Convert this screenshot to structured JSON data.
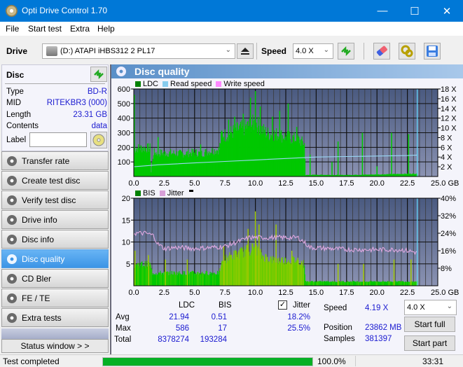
{
  "window": {
    "title": "Opti Drive Control 1.70",
    "minimize": "—",
    "maximize": "☐",
    "close": "✕"
  },
  "menu": [
    "File",
    "Start test",
    "Extra",
    "Help"
  ],
  "toolbar": {
    "drive_label": "Drive",
    "drive_value": "(D:)  ATAPI iHBS312  2 PL17",
    "speed_label": "Speed",
    "speed_value": "4.0 X",
    "icons": [
      "drive-icon",
      "eject-icon",
      "refresh-icon",
      "eraser-icon",
      "settings-icon",
      "save-icon"
    ]
  },
  "disc": {
    "header": "Disc",
    "rows": [
      {
        "label": "Type",
        "value": "BD-R"
      },
      {
        "label": "MID",
        "value": "RITEKBR3 (000)"
      },
      {
        "label": "Length",
        "value": "23.31 GB"
      },
      {
        "label": "Contents",
        "value": "data"
      }
    ],
    "label_field": {
      "label": "Label",
      "value": ""
    }
  },
  "nav": [
    {
      "label": "Transfer rate",
      "active": false
    },
    {
      "label": "Create test disc",
      "active": false
    },
    {
      "label": "Verify test disc",
      "active": false
    },
    {
      "label": "Drive info",
      "active": false
    },
    {
      "label": "Disc info",
      "active": false
    },
    {
      "label": "Disc quality",
      "active": true
    },
    {
      "label": "CD Bler",
      "active": false
    },
    {
      "label": "FE / TE",
      "active": false
    },
    {
      "label": "Extra tests",
      "active": false
    }
  ],
  "status_window_button": "Status window > >",
  "main": {
    "title": "Disc quality",
    "colors": {
      "ldc": "#00c800",
      "bis": "#00c800",
      "read_speed": "#88ccee",
      "write_speed": "#ff88ff",
      "jitter": "#d8a0d8",
      "plot_bg_top": "#4a5a80",
      "plot_bg_bottom": "#8890b0"
    }
  },
  "chart_data": [
    {
      "type": "bar",
      "title": "LDC",
      "legend": [
        "LDC",
        "Read speed",
        "Write speed"
      ],
      "legend_placement": "top-left",
      "xlabel": "GB",
      "x_ticks": [
        "0.0",
        "2.5",
        "5.0",
        "7.5",
        "10.0",
        "12.5",
        "15.0",
        "17.5",
        "20.0",
        "22.5",
        "25.0 GB"
      ],
      "xlim": [
        0,
        25
      ],
      "y_ticks": [
        "100",
        "200",
        "300",
        "400",
        "500",
        "600"
      ],
      "ylim": [
        0,
        600
      ],
      "y2_ticks": [
        "2 X",
        "4 X",
        "6 X",
        "8 X",
        "10 X",
        "12 X",
        "14 X",
        "16 X",
        "18 X"
      ],
      "y2lim": [
        0,
        18
      ],
      "ldc_envelope": {
        "x": [
          0,
          0.2,
          1.3,
          1.4,
          1.6,
          2.0,
          3.0,
          4.0,
          5.0,
          5.5,
          6.0,
          7.0,
          7.2,
          7.5,
          8.0,
          8.5,
          9.0,
          9.5,
          10.0,
          10.5,
          11.0,
          11.5,
          12.0,
          12.5,
          13.0,
          13.5,
          14.0,
          14.1,
          15.0,
          17.0,
          20.0,
          22.0,
          23.3
        ],
        "base": [
          190,
          200,
          200,
          30,
          170,
          165,
          165,
          160,
          170,
          160,
          175,
          190,
          300,
          290,
          310,
          330,
          340,
          360,
          380,
          330,
          300,
          300,
          290,
          280,
          270,
          260,
          230,
          10,
          12,
          10,
          14,
          18,
          20
        ]
      },
      "ldc_spikes": [
        {
          "x": 0.05,
          "y": 560
        },
        {
          "x": 2.0,
          "y": 270
        },
        {
          "x": 5.5,
          "y": 220
        },
        {
          "x": 7.8,
          "y": 390
        },
        {
          "x": 8.3,
          "y": 410
        },
        {
          "x": 9.0,
          "y": 430
        },
        {
          "x": 9.6,
          "y": 540
        },
        {
          "x": 10.0,
          "y": 586
        },
        {
          "x": 10.4,
          "y": 480
        },
        {
          "x": 11.4,
          "y": 410
        },
        {
          "x": 12.0,
          "y": 450
        },
        {
          "x": 12.7,
          "y": 500
        },
        {
          "x": 13.4,
          "y": 340
        },
        {
          "x": 14.5,
          "y": 150
        },
        {
          "x": 16.3,
          "y": 100
        },
        {
          "x": 16.8,
          "y": 240
        },
        {
          "x": 18.8,
          "y": 300
        },
        {
          "x": 20.0,
          "y": 70
        },
        {
          "x": 21.2,
          "y": 300
        },
        {
          "x": 22.6,
          "y": 290
        }
      ],
      "read_speed": {
        "x": [
          0,
          2,
          5,
          7.5,
          10,
          12.5,
          15,
          17.5,
          20,
          22.5,
          23.3
        ],
        "values": [
          2.0,
          2.4,
          2.8,
          3.1,
          3.4,
          3.7,
          4.0,
          4.1,
          4.2,
          4.3,
          4.4
        ]
      },
      "end_marker_gb": 23.31
    },
    {
      "type": "bar",
      "title": "BIS / Jitter",
      "legend": [
        "BIS",
        "Jitter"
      ],
      "legend_placement": "top-left",
      "xlabel": "GB",
      "x_ticks": [
        "0.0",
        "2.5",
        "5.0",
        "7.5",
        "10.0",
        "12.5",
        "15.0",
        "17.5",
        "20.0",
        "22.5",
        "25.0 GB"
      ],
      "xlim": [
        0,
        25
      ],
      "y_ticks": [
        "5",
        "10",
        "15",
        "20"
      ],
      "ylim": [
        0,
        20
      ],
      "y2_ticks": [
        "8%",
        "16%",
        "24%",
        "32%",
        "40%"
      ],
      "y2lim": [
        0,
        40
      ],
      "bis_envelope": {
        "x": [
          0,
          1.3,
          1.5,
          3.0,
          5.0,
          7.0,
          7.3,
          8.0,
          9.0,
          10.0,
          10.5,
          11.5,
          12.5,
          13.5,
          14.0,
          14.1,
          17.0,
          20.0,
          23.3
        ],
        "values": [
          5,
          5,
          3,
          3,
          3,
          3,
          6,
          7,
          8,
          9,
          7,
          6,
          6,
          6,
          5,
          1,
          1,
          1,
          1
        ]
      },
      "bis_spikes": [
        {
          "x": 0.1,
          "y": 8
        },
        {
          "x": 1.2,
          "y": 7
        },
        {
          "x": 2.6,
          "y": 6
        },
        {
          "x": 4.4,
          "y": 6
        },
        {
          "x": 7.4,
          "y": 9
        },
        {
          "x": 9.4,
          "y": 13
        },
        {
          "x": 10.0,
          "y": 17
        },
        {
          "x": 10.3,
          "y": 14
        },
        {
          "x": 11.7,
          "y": 14
        },
        {
          "x": 13.0,
          "y": 8
        },
        {
          "x": 16.8,
          "y": 5
        },
        {
          "x": 18.9,
          "y": 5
        },
        {
          "x": 21.4,
          "y": 6
        },
        {
          "x": 22.8,
          "y": 6
        }
      ],
      "jitter": {
        "x": [
          0,
          0.5,
          1.0,
          1.6,
          2.0,
          2.5,
          3.5,
          5.0,
          6.5,
          7.5,
          8.5,
          9.5,
          10.5,
          11.5,
          12.5,
          13.5,
          14.0,
          14.5,
          16.0,
          18.0,
          20.0,
          22.0,
          23.0,
          23.3
        ],
        "values": [
          24,
          24,
          24,
          23,
          19,
          17,
          17.5,
          17,
          17.5,
          18,
          20,
          22,
          22,
          22,
          22,
          22,
          20,
          17.5,
          17,
          16.5,
          16.5,
          16.5,
          15.5,
          15
        ]
      },
      "end_marker_gb": 23.31
    }
  ],
  "stats": {
    "headers": {
      "ldc": "LDC",
      "bis": "BIS",
      "jitter": "Jitter"
    },
    "jitter_checked": true,
    "rows": [
      {
        "label": "Avg",
        "ldc": "21.94",
        "bis": "0.51",
        "jitter": "18.2%"
      },
      {
        "label": "Max",
        "ldc": "586",
        "bis": "17",
        "jitter": "25.5%"
      },
      {
        "label": "Total",
        "ldc": "8378274",
        "bis": "193284",
        "jitter": ""
      }
    ],
    "speed_label": "Speed",
    "speed_value": "4.19 X",
    "position_label": "Position",
    "position_value": "23862 MB",
    "samples_label": "Samples",
    "samples_value": "381397",
    "speed_select": "4.0 X",
    "start_full": "Start full",
    "start_part": "Start part"
  },
  "statusbar": {
    "text": "Test completed",
    "progress": 100.0,
    "progress_text": "100.0%",
    "time": "33:31"
  }
}
